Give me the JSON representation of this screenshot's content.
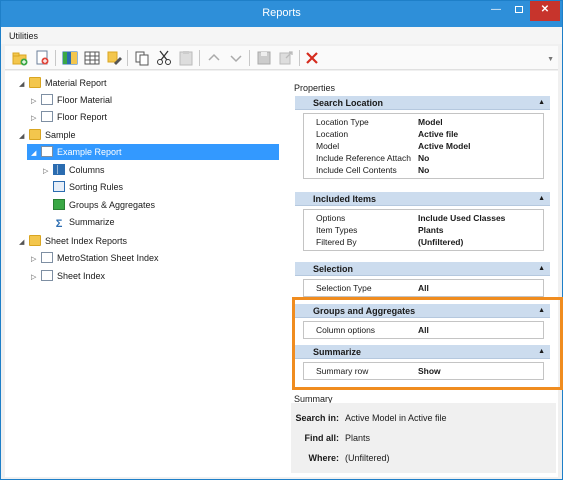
{
  "window": {
    "title": "Reports"
  },
  "menu": {
    "utilities": "Utilities"
  },
  "tree": {
    "items": [
      {
        "label": "Material Report",
        "arrow": "◢",
        "kind": "folder"
      },
      {
        "label": "Floor Material",
        "arrow": "▷",
        "kind": "doc"
      },
      {
        "label": "Floor Report",
        "arrow": "▷",
        "kind": "doc"
      },
      {
        "label": "Sample",
        "arrow": "◢",
        "kind": "folder"
      },
      {
        "label": "Example Report",
        "arrow": "◢",
        "kind": "doc"
      },
      {
        "label": "Columns",
        "arrow": "▷",
        "kind": "cols"
      },
      {
        "label": "Sorting Rules",
        "arrow": "",
        "kind": "sort"
      },
      {
        "label": "Groups & Aggregates",
        "arrow": "",
        "kind": "group"
      },
      {
        "label": "Summarize",
        "arrow": "",
        "kind": "sum"
      },
      {
        "label": "Sheet Index Reports",
        "arrow": "◢",
        "kind": "folder"
      },
      {
        "label": "MetroStation Sheet Index",
        "arrow": "▷",
        "kind": "doc"
      },
      {
        "label": "Sheet Index",
        "arrow": "▷",
        "kind": "doc"
      }
    ]
  },
  "properties": {
    "label": "Properties",
    "groups": [
      {
        "title": "Search Location",
        "rows": [
          {
            "k": "Location Type",
            "v": "Model"
          },
          {
            "k": "Location",
            "v": "Active file"
          },
          {
            "k": "Model",
            "v": "Active Model"
          },
          {
            "k": "Include Reference Attach",
            "v": "No"
          },
          {
            "k": "Include Cell Contents",
            "v": "No"
          }
        ]
      },
      {
        "title": "Included Items",
        "rows": [
          {
            "k": "Options",
            "v": "Include Used Classes"
          },
          {
            "k": "Item Types",
            "v": "Plants"
          },
          {
            "k": "Filtered By",
            "v": "(Unfiltered)"
          }
        ]
      },
      {
        "title": "Selection",
        "rows": [
          {
            "k": "Selection Type",
            "v": "All"
          }
        ]
      },
      {
        "title": "Groups and Aggregates",
        "rows": [
          {
            "k": "Column options",
            "v": "All"
          }
        ]
      },
      {
        "title": "Summarize",
        "rows": [
          {
            "k": "Summary row",
            "v": "Show"
          }
        ]
      }
    ]
  },
  "summary": {
    "label": "Summary",
    "search_in_k": "Search in:",
    "search_in_v": "Active Model  in Active file",
    "find_all_k": "Find all:",
    "find_all_v": "Plants",
    "where_k": "Where:",
    "where_v": "(Unfiltered)"
  },
  "colors": {
    "accent": "#2e8fd9",
    "highlight": "#f08c1f",
    "selected": "#3399ff",
    "group_header": "#ccdcee"
  },
  "icons": {
    "caret": "▲",
    "minimize": "—",
    "close": "✕"
  }
}
